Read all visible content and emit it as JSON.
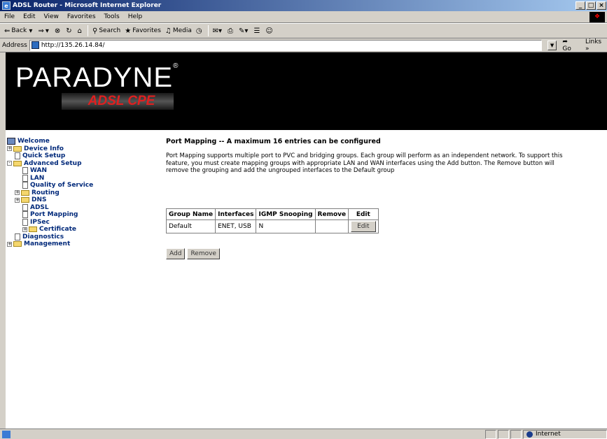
{
  "window": {
    "title": "ADSL Router - Microsoft Internet Explorer",
    "min": "_",
    "max": "×"
  },
  "menu": [
    "File",
    "Edit",
    "View",
    "Favorites",
    "Tools",
    "Help"
  ],
  "toolbar": {
    "back": "Back",
    "search": "Search",
    "favorites": "Favorites",
    "media": "Media"
  },
  "address": {
    "label": "Address",
    "url": "http://135.26.14.84/",
    "go": "Go",
    "links": "Links"
  },
  "banner": {
    "brand": "PARADYNE",
    "product": "ADSL CPE"
  },
  "tree": [
    {
      "label": "Welcome",
      "kind": "computer"
    },
    {
      "label": "Device Info",
      "kind": "folder",
      "expander": "+"
    },
    {
      "label": "Quick Setup",
      "kind": "doc"
    },
    {
      "label": "Advanced Setup",
      "kind": "folder",
      "expander": "-"
    },
    {
      "label": "WAN",
      "kind": "doc"
    },
    {
      "label": "LAN",
      "kind": "doc"
    },
    {
      "label": "Quality of Service",
      "kind": "doc"
    },
    {
      "label": "Routing",
      "kind": "folder",
      "expander": "+"
    },
    {
      "label": "DNS",
      "kind": "folder",
      "expander": "+"
    },
    {
      "label": "ADSL",
      "kind": "doc"
    },
    {
      "label": "Port Mapping",
      "kind": "doc"
    },
    {
      "label": "IPSec",
      "kind": "doc"
    },
    {
      "label": "Certificate",
      "kind": "folder",
      "expander": "+"
    },
    {
      "label": "Diagnostics",
      "kind": "doc"
    },
    {
      "label": "Management",
      "kind": "folder",
      "expander": "+"
    }
  ],
  "main": {
    "title": "Port Mapping -- A maximum 16 entries can be configured",
    "description": "Port Mapping supports multiple port to PVC and bridging groups. Each group will perform as an independent network. To support this feature, you must create mapping groups with appropriate LAN and WAN interfaces using the Add button. The Remove button will remove the grouping and add the ungrouped interfaces to the Default group",
    "table": {
      "headers": [
        "Group Name",
        "Interfaces",
        "IGMP Snooping",
        "Remove",
        "Edit"
      ],
      "rows": [
        {
          "group": "Default",
          "interfaces": "ENET, USB",
          "igmp": "N",
          "remove": "",
          "edit": "Edit"
        }
      ]
    },
    "add_label": "Add",
    "remove_label": "Remove"
  },
  "status": {
    "zone": "Internet"
  }
}
